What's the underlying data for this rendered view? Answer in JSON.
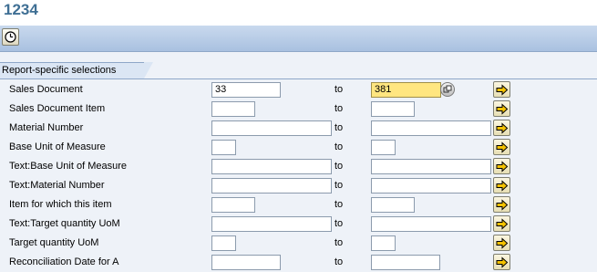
{
  "window": {
    "title": "1234"
  },
  "toolbar": {
    "execute_icon": "execute-clock-icon"
  },
  "group": {
    "title": "Report-specific selections"
  },
  "range_label": "to",
  "rows": [
    {
      "label": "Sales Document",
      "from": "33",
      "to": "381"
    },
    {
      "label": "Sales Document Item",
      "from": "",
      "to": ""
    },
    {
      "label": "Material Number",
      "from": "",
      "to": ""
    },
    {
      "label": "Base Unit of Measure",
      "from": "",
      "to": ""
    },
    {
      "label": "Text:Base Unit of Measure",
      "from": "",
      "to": ""
    },
    {
      "label": "Text:Material Number",
      "from": "",
      "to": ""
    },
    {
      "label": "Item for which this item",
      "from": "",
      "to": ""
    },
    {
      "label": "Text:Target quantity UoM",
      "from": "",
      "to": ""
    },
    {
      "label": "Target quantity UoM",
      "from": "",
      "to": ""
    },
    {
      "label": "Reconciliation Date for A",
      "from": "",
      "to": ""
    }
  ],
  "icons": {
    "value_help": "value-help-icon",
    "multiple_selection": "multiple-selection-arrow-icon"
  },
  "colors": {
    "title": "#3f6f94",
    "highlight": "#ffe680",
    "toolbar": "#b9cde8"
  }
}
